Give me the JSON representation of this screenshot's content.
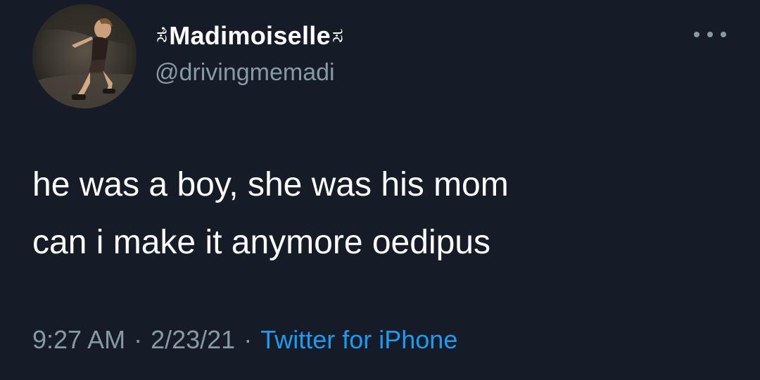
{
  "user": {
    "display_name": "Madimoiselle",
    "name_flourish_left": "ಸ̓",
    "name_flourish_right": "ಸ",
    "handle": "@drivingmemadi"
  },
  "tweet": {
    "lines": [
      "he was a boy, she was his mom",
      "can i make it anymore oedipus"
    ]
  },
  "meta": {
    "time": "9:27 AM",
    "date": "2/23/21",
    "separator": "·",
    "source": "Twitter for iPhone"
  },
  "icons": {
    "more": "more-options-icon"
  },
  "colors": {
    "background": "#161c27",
    "text": "#ffffff",
    "secondary": "#8899a6",
    "link": "#1d9bf0"
  }
}
